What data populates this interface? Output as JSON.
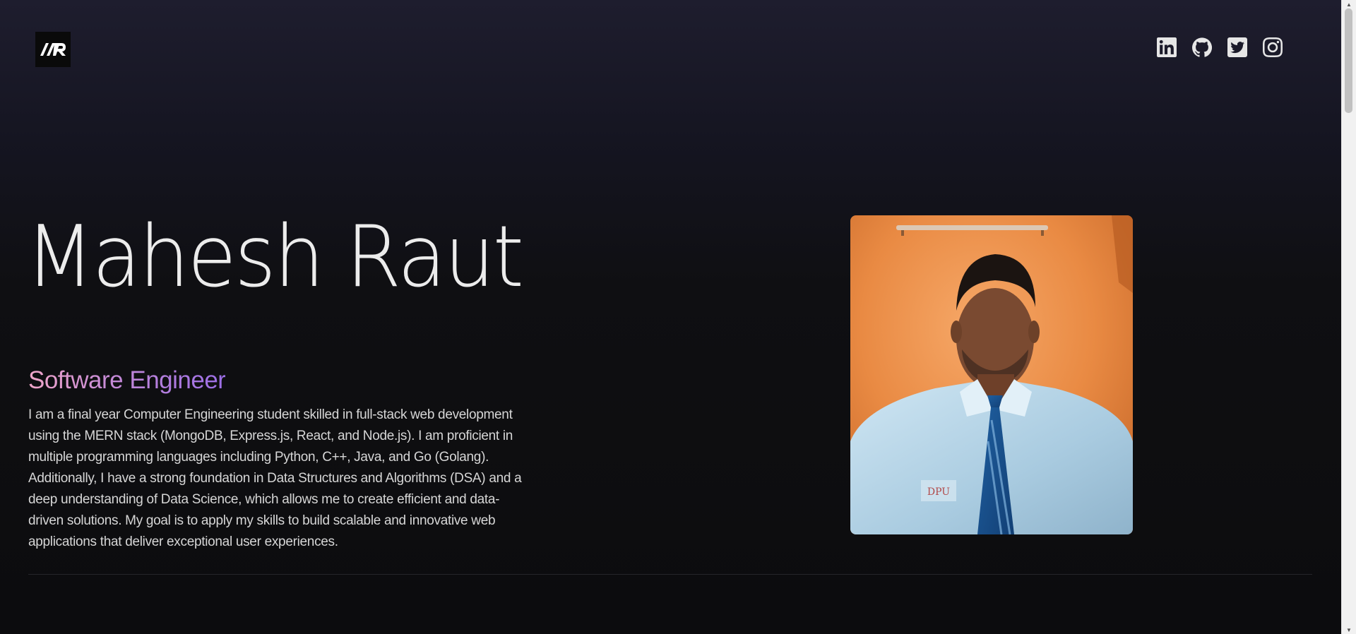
{
  "header": {
    "logo_icon": "mr-monogram-logo",
    "socials": [
      {
        "name": "linkedin-icon"
      },
      {
        "name": "github-icon"
      },
      {
        "name": "twitter-icon"
      },
      {
        "name": "instagram-icon"
      }
    ]
  },
  "hero": {
    "name": "Mahesh Raut",
    "role": "Software Engineer",
    "bio": "I am a final year Computer Engineering student skilled in full-stack web development using the MERN stack (MongoDB, Express.js, React, and Node.js). I am proficient in multiple programming languages including Python, C++, Java, and Go (Golang). Additionally, I have a strong foundation in Data Structures and Algorithms (DSA) and a deep understanding of Data Science, which allows me to create efficient and data-driven solutions. My goal is to apply my skills to build scalable and innovative web applications that deliver exceptional user experiences.",
    "photo_badge": "DPU"
  },
  "colors": {
    "background": "#0d0d0f",
    "text": "#ececec",
    "role_gradient_start": "#f0a6c9",
    "role_gradient_end": "#9b6ee6"
  }
}
